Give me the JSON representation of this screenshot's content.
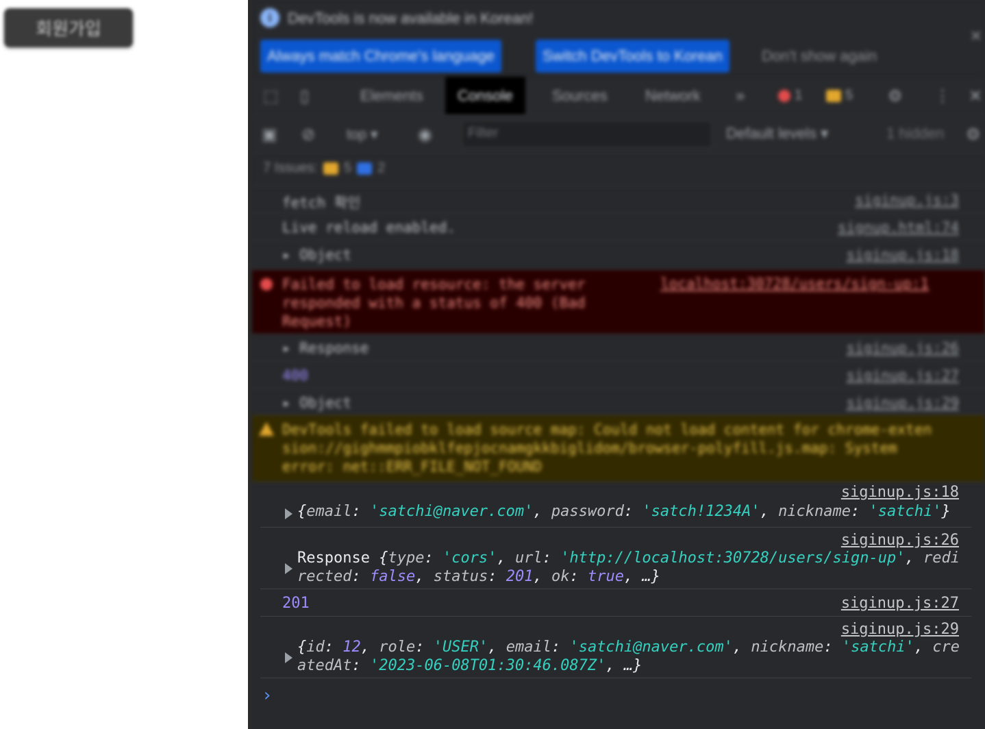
{
  "page": {
    "signup_button": "회원가입"
  },
  "devtools": {
    "infobar": {
      "message": "DevTools is now available in Korean!",
      "btn_match": "Always match Chrome's language",
      "btn_switch": "Switch DevTools to Korean",
      "btn_dismiss": "Don't show again"
    },
    "tabs": [
      "Elements",
      "Console",
      "Sources",
      "Network"
    ],
    "active_tab": "Console",
    "error_count": "1",
    "warning_count": "5",
    "toolbar": {
      "context": "top ▾",
      "filter_placeholder": "Filter",
      "levels": "Default levels ▾",
      "hidden": "1 hidden"
    },
    "issues": {
      "label": "7 Issues:",
      "warnings": "5",
      "info": "2"
    },
    "blurred_logs": [
      {
        "msg": "fetch 확인",
        "src": "siginup.js:3"
      },
      {
        "msg": "Live reload enabled.",
        "src": "signup.html:74"
      },
      {
        "msg": "▸ Object",
        "src": "siginup.js:18"
      },
      {
        "msg": "Failed to load resource: the server\nresponded with a status of 400 (Bad\nRequest)",
        "src": "localhost:30728/users/sign-up:1"
      },
      {
        "msg": "▸ Response",
        "src": "siginup.js:26"
      },
      {
        "msg": "400",
        "src": "siginup.js:27"
      },
      {
        "msg": "▸ Object",
        "src": "siginup.js:29"
      },
      {
        "msg": "DevTools failed to load source map: Could not load content for chrome-exten\nsion://gighmmpiobklfepjocnamgkkbiglidom/browser-polyfill.js.map: System\nerror: net::ERR_FILE_NOT_FOUND",
        "src": ""
      }
    ],
    "logs": [
      {
        "src": "siginup.js:18",
        "email_key": "email",
        "email_val": "'satchi@naver.com'",
        "password_key": "password",
        "password_val": "'satch!1234A'",
        "nickname_key": "nickname",
        "nickname_val": "'satchi'"
      },
      {
        "src": "siginup.js:26",
        "name": "Response",
        "type_key": "type",
        "type_val": "'cors'",
        "url_key": "url",
        "url_val": "'http://localhost:30728/users/sign-up'",
        "redi": "redi",
        "rected": "rected",
        "redirected_val": "false",
        "status_key": "status",
        "status_val": "201",
        "ok_key": "ok",
        "ok_val": "true"
      },
      {
        "src": "siginup.js:27",
        "value": "201"
      },
      {
        "src": "siginup.js:29",
        "id_key": "id",
        "id_val": "12",
        "role_key": "role",
        "role_val": "'USER'",
        "email_key": "email",
        "email_val": "'satchi@naver.com'",
        "nickname_key": "nickname",
        "nickname_val": "'satchi'",
        "cre": "cre",
        "ated": "atedAt",
        "created_val": "'2023-06-08T01:30:46.087Z'"
      }
    ],
    "prompt": "›"
  }
}
